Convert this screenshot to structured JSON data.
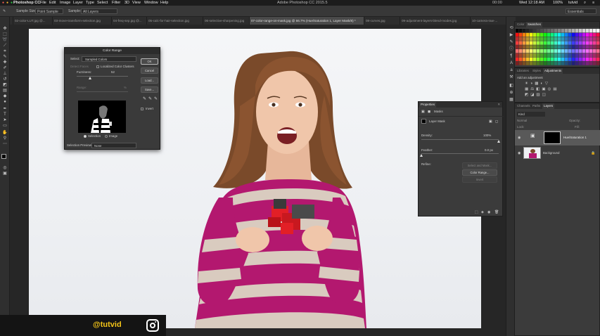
{
  "menubar": {
    "app_name": "Photoshop CC",
    "menus": [
      "File",
      "Edit",
      "Image",
      "Layer",
      "Type",
      "Select",
      "Filter",
      "3D",
      "View",
      "Window",
      "Help"
    ],
    "title": "Adobe Photoshop CC 2015.5",
    "battery": "100%",
    "clock": "Wed 12:18 AM",
    "user": "tutvid",
    "status_time": "00:00"
  },
  "options": {
    "sample_size_label": "Sample Size:",
    "sample_size_value": "Point Sample",
    "sample_label": "Sample:",
    "sample_value": "All Layers",
    "workspace": "Essentials"
  },
  "tabs": [
    "02-color-LUT.jpg @...",
    "03-move-transform-selection.jpg",
    "04-freq-sep.jpg @...",
    "05-calc-for-hair-selection.jpg",
    "06-selective-sharpening.jpg",
    "07-color-range-on-mask.jpg @ 66.7% (Hue/Saturation 1, Layer Mask/8) *",
    "08-curves.jpg",
    "09-adjustment-layers-blend-modes.jpg",
    "10-camera-raw-..."
  ],
  "color_range": {
    "title": "Color Range",
    "select_label": "Select:",
    "select_value": "Sampled Colors",
    "detect_faces": "Detect Faces",
    "localized": "Localized Color Clusters",
    "fuzziness_label": "Fuzziness:",
    "fuzziness_value": "52",
    "fuzziness_fraction": 0.26,
    "range_label": "Range:",
    "range_unit": "%",
    "ok": "OK",
    "cancel": "Cancel",
    "load": "Load...",
    "save": "Save...",
    "invert": "Invert",
    "selection": "Selection",
    "image": "Image",
    "preview_label": "Selection Preview:",
    "preview_value": "None"
  },
  "properties": {
    "tab": "Properties",
    "masks": "Masks",
    "layer_mask": "Layer Mask",
    "density_label": "Density:",
    "density_value": "100%",
    "density_fraction": 1.0,
    "feather_label": "Feather:",
    "feather_value": "0.0 px",
    "feather_fraction": 0.0,
    "refine": "Refine:",
    "select_mask": "Select and Mask...",
    "color_range": "Color Range...",
    "invert": "Invert"
  },
  "swatches_panel": {
    "tabs": [
      "Color",
      "Swatches"
    ]
  },
  "adjustments_panel": {
    "tabs": [
      "Libraries",
      "Styles",
      "Adjustments"
    ],
    "add_label": "Add an adjustment"
  },
  "layers_panel": {
    "tabs": [
      "Channels",
      "Paths",
      "Layers"
    ],
    "kind": "Kind",
    "blend": "Normal",
    "opacity_label": "Opacity:",
    "lock_label": "Lock:",
    "fill_label": "Fill:",
    "layers": [
      {
        "name": "Hue/Saturation 1"
      },
      {
        "name": "Background"
      }
    ]
  },
  "watermark": {
    "handle": "@tutvid"
  },
  "colors": {
    "accent": "#f5c518",
    "ui_dark": "#262626",
    "panel": "#3b3b3b",
    "shirt_magenta": "#b3186f",
    "cube_red": "#e21f26"
  }
}
